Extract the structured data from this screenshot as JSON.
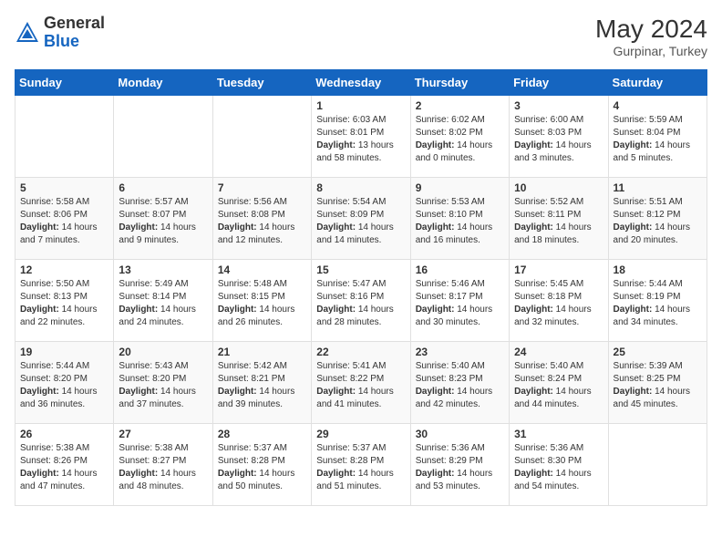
{
  "header": {
    "logo_general": "General",
    "logo_blue": "Blue",
    "month_year": "May 2024",
    "location": "Gurpinar, Turkey"
  },
  "days_of_week": [
    "Sunday",
    "Monday",
    "Tuesday",
    "Wednesday",
    "Thursday",
    "Friday",
    "Saturday"
  ],
  "weeks": [
    [
      {
        "day": "",
        "info": ""
      },
      {
        "day": "",
        "info": ""
      },
      {
        "day": "",
        "info": ""
      },
      {
        "day": "1",
        "info": "Sunrise: 6:03 AM\nSunset: 8:01 PM\nDaylight: 13 hours and 58 minutes."
      },
      {
        "day": "2",
        "info": "Sunrise: 6:02 AM\nSunset: 8:02 PM\nDaylight: 14 hours and 0 minutes."
      },
      {
        "day": "3",
        "info": "Sunrise: 6:00 AM\nSunset: 8:03 PM\nDaylight: 14 hours and 3 minutes."
      },
      {
        "day": "4",
        "info": "Sunrise: 5:59 AM\nSunset: 8:04 PM\nDaylight: 14 hours and 5 minutes."
      }
    ],
    [
      {
        "day": "5",
        "info": "Sunrise: 5:58 AM\nSunset: 8:06 PM\nDaylight: 14 hours and 7 minutes."
      },
      {
        "day": "6",
        "info": "Sunrise: 5:57 AM\nSunset: 8:07 PM\nDaylight: 14 hours and 9 minutes."
      },
      {
        "day": "7",
        "info": "Sunrise: 5:56 AM\nSunset: 8:08 PM\nDaylight: 14 hours and 12 minutes."
      },
      {
        "day": "8",
        "info": "Sunrise: 5:54 AM\nSunset: 8:09 PM\nDaylight: 14 hours and 14 minutes."
      },
      {
        "day": "9",
        "info": "Sunrise: 5:53 AM\nSunset: 8:10 PM\nDaylight: 14 hours and 16 minutes."
      },
      {
        "day": "10",
        "info": "Sunrise: 5:52 AM\nSunset: 8:11 PM\nDaylight: 14 hours and 18 minutes."
      },
      {
        "day": "11",
        "info": "Sunrise: 5:51 AM\nSunset: 8:12 PM\nDaylight: 14 hours and 20 minutes."
      }
    ],
    [
      {
        "day": "12",
        "info": "Sunrise: 5:50 AM\nSunset: 8:13 PM\nDaylight: 14 hours and 22 minutes."
      },
      {
        "day": "13",
        "info": "Sunrise: 5:49 AM\nSunset: 8:14 PM\nDaylight: 14 hours and 24 minutes."
      },
      {
        "day": "14",
        "info": "Sunrise: 5:48 AM\nSunset: 8:15 PM\nDaylight: 14 hours and 26 minutes."
      },
      {
        "day": "15",
        "info": "Sunrise: 5:47 AM\nSunset: 8:16 PM\nDaylight: 14 hours and 28 minutes."
      },
      {
        "day": "16",
        "info": "Sunrise: 5:46 AM\nSunset: 8:17 PM\nDaylight: 14 hours and 30 minutes."
      },
      {
        "day": "17",
        "info": "Sunrise: 5:45 AM\nSunset: 8:18 PM\nDaylight: 14 hours and 32 minutes."
      },
      {
        "day": "18",
        "info": "Sunrise: 5:44 AM\nSunset: 8:19 PM\nDaylight: 14 hours and 34 minutes."
      }
    ],
    [
      {
        "day": "19",
        "info": "Sunrise: 5:44 AM\nSunset: 8:20 PM\nDaylight: 14 hours and 36 minutes."
      },
      {
        "day": "20",
        "info": "Sunrise: 5:43 AM\nSunset: 8:20 PM\nDaylight: 14 hours and 37 minutes."
      },
      {
        "day": "21",
        "info": "Sunrise: 5:42 AM\nSunset: 8:21 PM\nDaylight: 14 hours and 39 minutes."
      },
      {
        "day": "22",
        "info": "Sunrise: 5:41 AM\nSunset: 8:22 PM\nDaylight: 14 hours and 41 minutes."
      },
      {
        "day": "23",
        "info": "Sunrise: 5:40 AM\nSunset: 8:23 PM\nDaylight: 14 hours and 42 minutes."
      },
      {
        "day": "24",
        "info": "Sunrise: 5:40 AM\nSunset: 8:24 PM\nDaylight: 14 hours and 44 minutes."
      },
      {
        "day": "25",
        "info": "Sunrise: 5:39 AM\nSunset: 8:25 PM\nDaylight: 14 hours and 45 minutes."
      }
    ],
    [
      {
        "day": "26",
        "info": "Sunrise: 5:38 AM\nSunset: 8:26 PM\nDaylight: 14 hours and 47 minutes."
      },
      {
        "day": "27",
        "info": "Sunrise: 5:38 AM\nSunset: 8:27 PM\nDaylight: 14 hours and 48 minutes."
      },
      {
        "day": "28",
        "info": "Sunrise: 5:37 AM\nSunset: 8:28 PM\nDaylight: 14 hours and 50 minutes."
      },
      {
        "day": "29",
        "info": "Sunrise: 5:37 AM\nSunset: 8:28 PM\nDaylight: 14 hours and 51 minutes."
      },
      {
        "day": "30",
        "info": "Sunrise: 5:36 AM\nSunset: 8:29 PM\nDaylight: 14 hours and 53 minutes."
      },
      {
        "day": "31",
        "info": "Sunrise: 5:36 AM\nSunset: 8:30 PM\nDaylight: 14 hours and 54 minutes."
      },
      {
        "day": "",
        "info": ""
      }
    ]
  ]
}
